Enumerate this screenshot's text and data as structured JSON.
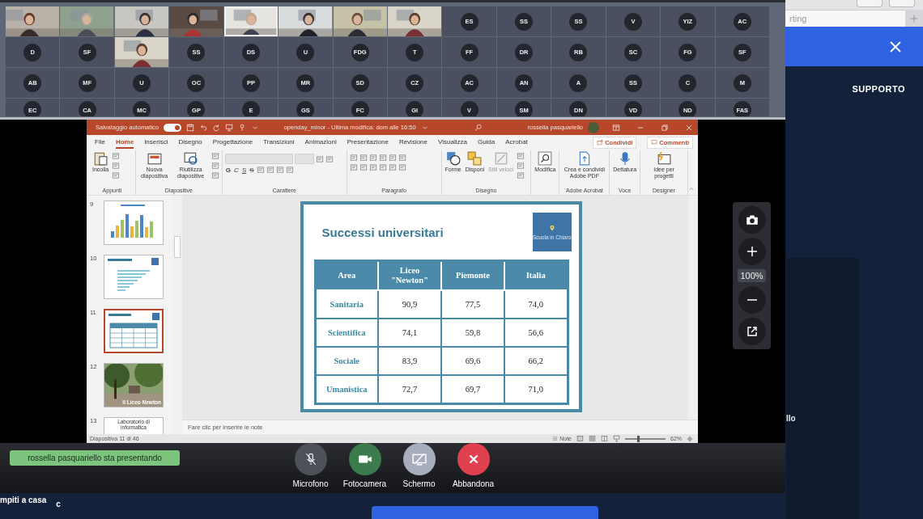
{
  "browser": {
    "tab_text": "rting",
    "support_label": "SUPPORTO",
    "panel_text": "llo",
    "bottom_texts": [
      "mpiti a casa",
      "c"
    ]
  },
  "conference": {
    "participant_rows": [
      [
        {
          "kind": "video",
          "active": false
        },
        {
          "kind": "video",
          "active": false
        },
        {
          "kind": "video",
          "active": false
        },
        {
          "kind": "video",
          "active": false
        },
        {
          "kind": "video",
          "active": true
        },
        {
          "kind": "video",
          "active": false
        },
        {
          "kind": "video",
          "active": false
        },
        {
          "kind": "video",
          "active": false
        },
        {
          "kind": "initials",
          "initials": "ES",
          "active": false
        },
        {
          "kind": "initials",
          "initials": "SS",
          "active": false
        },
        {
          "kind": "initials",
          "initials": "SS",
          "active": false
        },
        {
          "kind": "initials",
          "initials": "V",
          "active": false
        },
        {
          "kind": "initials",
          "initials": "YIZ",
          "active": false
        },
        {
          "kind": "initials",
          "initials": "AC",
          "active": false
        }
      ],
      [
        {
          "kind": "initials",
          "initials": "D",
          "active": false
        },
        {
          "kind": "initials",
          "initials": "SF",
          "active": false
        },
        {
          "kind": "video",
          "active": false
        },
        {
          "kind": "initials",
          "initials": "SS",
          "active": false
        },
        {
          "kind": "initials",
          "initials": "DS",
          "active": false
        },
        {
          "kind": "initials",
          "initials": "U",
          "active": false
        },
        {
          "kind": "initials",
          "initials": "FDG",
          "active": false
        },
        {
          "kind": "initials",
          "initials": "T",
          "active": false
        },
        {
          "kind": "initials",
          "initials": "FF",
          "active": false
        },
        {
          "kind": "initials",
          "initials": "DR",
          "active": false
        },
        {
          "kind": "initials",
          "initials": "RB",
          "active": false
        },
        {
          "kind": "initials",
          "initials": "SC",
          "active": false
        },
        {
          "kind": "initials",
          "initials": "FG",
          "active": false
        },
        {
          "kind": "initials",
          "initials": "SF",
          "active": false
        }
      ],
      [
        {
          "kind": "initials",
          "initials": "AB",
          "active": false
        },
        {
          "kind": "initials",
          "initials": "MF",
          "active": false
        },
        {
          "kind": "initials",
          "initials": "U",
          "active": false
        },
        {
          "kind": "initials",
          "initials": "OC",
          "active": false
        },
        {
          "kind": "initials",
          "initials": "PP",
          "active": false
        },
        {
          "kind": "initials",
          "initials": "MR",
          "active": false
        },
        {
          "kind": "initials",
          "initials": "SD",
          "active": false
        },
        {
          "kind": "initials",
          "initials": "CZ",
          "active": false
        },
        {
          "kind": "initials",
          "initials": "AC",
          "active": false
        },
        {
          "kind": "initials",
          "initials": "AN",
          "active": false
        },
        {
          "kind": "initials",
          "initials": "A",
          "active": false
        },
        {
          "kind": "initials",
          "initials": "SS",
          "active": false
        },
        {
          "kind": "initials",
          "initials": "C",
          "active": false
        },
        {
          "kind": "initials",
          "initials": "M",
          "active": false
        }
      ],
      [
        {
          "kind": "initials",
          "initials": "EC",
          "active": false
        },
        {
          "kind": "initials",
          "initials": "CA",
          "active": false
        },
        {
          "kind": "initials",
          "initials": "MC",
          "active": false
        },
        {
          "kind": "initials",
          "initials": "GP",
          "active": false
        },
        {
          "kind": "initials",
          "initials": "E",
          "active": false
        },
        {
          "kind": "initials",
          "initials": "GS",
          "active": false
        },
        {
          "kind": "initials",
          "initials": "FC",
          "active": false
        },
        {
          "kind": "initials",
          "initials": "GI",
          "active": false
        },
        {
          "kind": "initials",
          "initials": "V",
          "active": false
        },
        {
          "kind": "initials",
          "initials": "SM",
          "active": false
        },
        {
          "kind": "initials",
          "initials": "DN",
          "active": false
        },
        {
          "kind": "initials",
          "initials": "VD",
          "active": false
        },
        {
          "kind": "initials",
          "initials": "ND",
          "active": false
        },
        {
          "kind": "initials",
          "initials": "FAS",
          "active": false
        }
      ]
    ],
    "zoom_level": "100%",
    "presenter_badge": "rossella pasquariello sta presentando",
    "controls": [
      {
        "kind": "microphone",
        "label": "Microfono"
      },
      {
        "kind": "camera",
        "label": "Fotocamera"
      },
      {
        "kind": "screen",
        "label": "Schermo"
      },
      {
        "kind": "leave",
        "label": "Abbandona"
      }
    ]
  },
  "powerpoint": {
    "autosave_label": "Salvataggio automatico",
    "autosave_on": true,
    "document_title": "openday_minor  -  Ultima modifica: dom alle 16:50",
    "user_name": "rossella pasquariello",
    "tabs": [
      {
        "label": "File",
        "selected": false
      },
      {
        "label": "Home",
        "selected": true
      },
      {
        "label": "Inserisci",
        "selected": false
      },
      {
        "label": "Disegno",
        "selected": false
      },
      {
        "label": "Progettazione",
        "selected": false
      },
      {
        "label": "Transizioni",
        "selected": false
      },
      {
        "label": "Animazioni",
        "selected": false
      },
      {
        "label": "Presentazione",
        "selected": false
      },
      {
        "label": "Revisione",
        "selected": false
      },
      {
        "label": "Visualizza",
        "selected": false
      },
      {
        "label": "Guida",
        "selected": false
      },
      {
        "label": "Acrobat",
        "selected": false
      }
    ],
    "share_buttons": [
      "Condividi",
      "Commenti"
    ],
    "ribbon_groups": [
      {
        "kind": "clipboard",
        "label": "Appunti",
        "buttons": [
          {
            "kind": "paste",
            "label": "Incolla",
            "disabled": false
          }
        ]
      },
      {
        "kind": "slides",
        "label": "Diapositive",
        "buttons": [
          {
            "kind": "new-slide",
            "label": "Nuova diapositiva",
            "disabled": false
          },
          {
            "kind": "reuse",
            "label": "Riutilizza diapositive",
            "disabled": false
          }
        ]
      },
      {
        "kind": "font",
        "label": "Carattere",
        "letters": [
          "G",
          "C",
          "S",
          "S"
        ]
      },
      {
        "kind": "paragraph",
        "label": "Paragrafo"
      },
      {
        "kind": "drawing",
        "label": "Disegno",
        "buttons": [
          {
            "kind": "shapes",
            "label": "Forme",
            "disabled": false
          },
          {
            "kind": "arrange",
            "label": "Disponi",
            "disabled": false
          },
          {
            "kind": "styles",
            "label": "Stili veloci",
            "disabled": true
          }
        ]
      },
      {
        "kind": "editing",
        "buttons": [
          {
            "kind": "find",
            "label": "Modifica",
            "disabled": false
          }
        ]
      },
      {
        "kind": "acrobat",
        "label": "Adobe Acrobat",
        "buttons": [
          {
            "kind": "pdf",
            "label": "Crea e condividi Adobe PDF",
            "disabled": false
          }
        ]
      },
      {
        "kind": "voice",
        "label": "Voce",
        "buttons": [
          {
            "kind": "dictate",
            "label": "Dettatura",
            "disabled": false
          }
        ]
      },
      {
        "kind": "designer",
        "label": "Designer",
        "buttons": [
          {
            "kind": "ideas",
            "label": "Idee per progetti",
            "disabled": false
          }
        ]
      }
    ],
    "thumbnails": [
      {
        "number": "9",
        "kind": "bar-chart",
        "selected": false
      },
      {
        "number": "10",
        "kind": "hbar-chart",
        "selected": false
      },
      {
        "number": "11",
        "kind": "table",
        "selected": true
      },
      {
        "number": "12",
        "caption": "Il Liceo Newton",
        "selected": false
      },
      {
        "number": "13",
        "kind": "title",
        "title": "Laboratorio di informatica",
        "selected": false
      }
    ],
    "slide": {
      "title": "Successi universitari",
      "logo_text": "Scuola in Chiaro",
      "table": {
        "columns": [
          "Area",
          "Liceo \"Newton\"",
          "Piemonte",
          "Italia"
        ],
        "rows": [
          [
            "Sanitaria",
            "90,9",
            "77,5",
            "74,0"
          ],
          [
            "Scientifica",
            "74,1",
            "59,8",
            "56,6"
          ],
          [
            "Sociale",
            "83,9",
            "69,6",
            "66,2"
          ],
          [
            "Umanistica",
            "72,7",
            "69,7",
            "71,0"
          ]
        ]
      }
    },
    "notes_placeholder": "Fare clic per inserire le note",
    "status": {
      "slide_counter": "Diapositiva 11 di 46",
      "notes_label": "Note",
      "zoom": "62%",
      "level": 0.3
    }
  }
}
